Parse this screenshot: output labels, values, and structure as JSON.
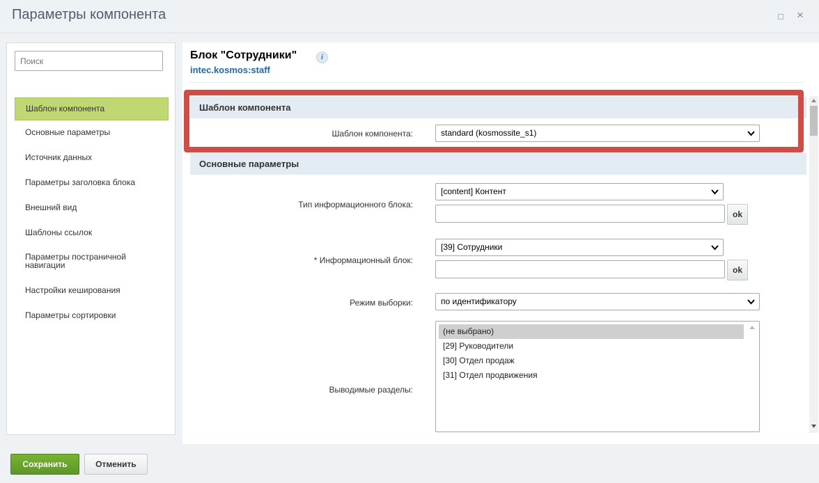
{
  "window": {
    "title": "Параметры компонента",
    "maximize_glyph": "□",
    "close_glyph": "×"
  },
  "sidebar": {
    "search_placeholder": "Поиск",
    "items": [
      {
        "label": "Шаблон компонента",
        "active": true
      },
      {
        "label": "Основные параметры"
      },
      {
        "label": "Источник данных"
      },
      {
        "label": "Параметры заголовка блока"
      },
      {
        "label": "Внешний вид"
      },
      {
        "label": "Шаблоны ссылок"
      },
      {
        "label": "Параметры постраничной навигации"
      },
      {
        "label": "Настройки кеширования"
      },
      {
        "label": "Параметры сортировки"
      }
    ]
  },
  "header": {
    "title": "Блок \"Сотрудники\"",
    "info_glyph": "i",
    "code": "intec.kosmos:staff"
  },
  "sections": {
    "template": {
      "title": "Шаблон компонента",
      "template_label": "Шаблон компонента:",
      "template_value": "standard (kosmossite_s1)"
    },
    "main": {
      "title": "Основные параметры",
      "iblock_type_label": "Тип информационного блока:",
      "iblock_type_value": "[content] Контент",
      "iblock_label": "* Информационный блок:",
      "iblock_value": "[39] Сотрудники",
      "ok_label": "ok",
      "mode_label": "Режим выборки:",
      "mode_value": "по идентификатору",
      "sections_label": "Выводимые разделы:",
      "sections_options": [
        {
          "label": "(не выбрано)",
          "selected": true
        },
        {
          "label": "[29] Руководители"
        },
        {
          "label": "[30] Отдел продаж"
        },
        {
          "label": "[31] Отдел продвижения"
        }
      ]
    }
  },
  "footer": {
    "save_label": "Сохранить",
    "cancel_label": "Отменить"
  },
  "colors": {
    "highlight_border": "#d14c44",
    "active_nav": "#bfd871",
    "save_button": "#6aa62c",
    "link_blue": "#2067b0"
  }
}
